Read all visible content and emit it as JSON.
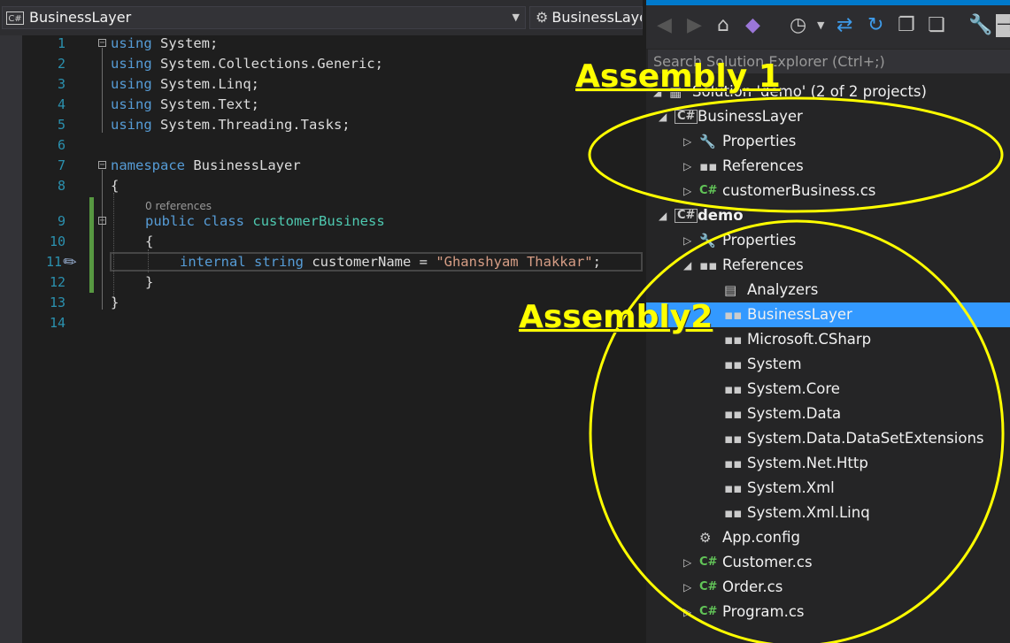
{
  "editor": {
    "nav_left": "BusinessLayer",
    "nav_right": "BusinessLayer",
    "cs_badge": "C#",
    "line_numbers": [
      "1",
      "2",
      "3",
      "4",
      "5",
      "6",
      "7",
      "8",
      "9",
      "10",
      "11",
      "12",
      "13",
      "14"
    ],
    "codelens": "0 references",
    "lines": {
      "l1_kw": "using",
      "l1_rest": " System;",
      "l2_kw": "using",
      "l2_rest": " System.Collections.Generic;",
      "l3_kw": "using",
      "l3_rest": " System.Linq;",
      "l4_kw": "using",
      "l4_rest": " System.Text;",
      "l5_kw": "using",
      "l5_rest": " System.Threading.Tasks;",
      "l7_kw": "namespace",
      "l7_rest": " BusinessLayer",
      "l8": "{",
      "l9_kw1": "public",
      "l9_kw2": "class",
      "l9_type": "customerBusiness",
      "l10": "{",
      "l11_kw1": "internal",
      "l11_kw2": "string",
      "l11_name": " customerName = ",
      "l11_str": "\"Ghanshyam Thakkar\"",
      "l11_end": ";",
      "l12": "}",
      "l13": "}"
    }
  },
  "solution_explorer": {
    "search_placeholder": "Search Solution Explorer (Ctrl+;)",
    "solution_label": "Solution 'demo' (2 of 2 projects)",
    "tree": [
      {
        "label": "BusinessLayer",
        "icon": "csharp-project-icon",
        "glyph": "C#",
        "expander": "◢"
      },
      {
        "label": "Properties",
        "icon": "wrench-icon",
        "glyph": "🔧",
        "expander": "▷"
      },
      {
        "label": "References",
        "icon": "references-icon",
        "glyph": "▪▪",
        "expander": "▷"
      },
      {
        "label": "customerBusiness.cs",
        "icon": "csharp-file-icon",
        "glyph": "C#",
        "expander": "▷"
      },
      {
        "label": "demo",
        "icon": "csharp-project-icon",
        "glyph": "C#",
        "expander": "◢"
      },
      {
        "label": "Properties",
        "icon": "wrench-icon",
        "glyph": "🔧",
        "expander": "▷"
      },
      {
        "label": "References",
        "icon": "references-icon",
        "glyph": "▪▪",
        "expander": "◢"
      },
      {
        "label": "Analyzers",
        "icon": "analyzers-icon",
        "glyph": "▤",
        "expander": ""
      },
      {
        "label": "BusinessLayer",
        "icon": "reference-item-icon",
        "glyph": "▪▪",
        "expander": ""
      },
      {
        "label": "Microsoft.CSharp",
        "icon": "reference-item-icon",
        "glyph": "▪▪",
        "expander": ""
      },
      {
        "label": "System",
        "icon": "reference-item-icon",
        "glyph": "▪▪",
        "expander": ""
      },
      {
        "label": "System.Core",
        "icon": "reference-item-icon",
        "glyph": "▪▪",
        "expander": ""
      },
      {
        "label": "System.Data",
        "icon": "reference-item-icon",
        "glyph": "▪▪",
        "expander": ""
      },
      {
        "label": "System.Data.DataSetExtensions",
        "icon": "reference-item-icon",
        "glyph": "▪▪",
        "expander": ""
      },
      {
        "label": "System.Net.Http",
        "icon": "reference-item-icon",
        "glyph": "▪▪",
        "expander": ""
      },
      {
        "label": "System.Xml",
        "icon": "reference-item-icon",
        "glyph": "▪▪",
        "expander": ""
      },
      {
        "label": "System.Xml.Linq",
        "icon": "reference-item-icon",
        "glyph": "▪▪",
        "expander": ""
      },
      {
        "label": "App.config",
        "icon": "config-file-icon",
        "glyph": "⚙",
        "expander": ""
      },
      {
        "label": "Customer.cs",
        "icon": "csharp-file-icon",
        "glyph": "C#",
        "expander": "▷"
      },
      {
        "label": "Order.cs",
        "icon": "csharp-file-icon",
        "glyph": "C#",
        "expander": "▷"
      },
      {
        "label": "Program.cs",
        "icon": "csharp-file-icon",
        "glyph": "C#",
        "expander": "▷"
      }
    ]
  },
  "annotations": {
    "assembly1": "Assembly 1",
    "assembly2": "Assembly2",
    "color": "#ffff00"
  },
  "colors": {
    "keyword": "#569cd6",
    "type": "#4ec9b0",
    "string": "#d69d85",
    "selection": "#3399ff"
  }
}
